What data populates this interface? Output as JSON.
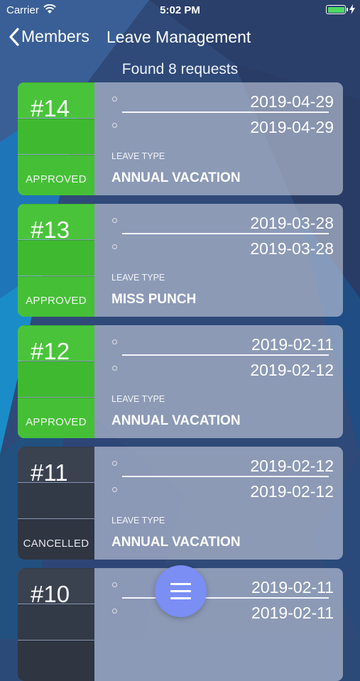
{
  "status_bar": {
    "carrier": "Carrier",
    "time": "5:02 PM",
    "battery_level": 1.0
  },
  "nav": {
    "back_label": "Members",
    "title": "Leave Management"
  },
  "summary": "Found 8 requests",
  "requests": [
    {
      "number": "#14",
      "status": "APPROVED",
      "from": "2019-04-29",
      "to": "2019-04-29",
      "leave_type_label": "LEAVE TYPE",
      "leave_type": "ANNUAL VACATION"
    },
    {
      "number": "#13",
      "status": "APPROVED",
      "from": "2019-03-28",
      "to": "2019-03-28",
      "leave_type_label": "LEAVE TYPE",
      "leave_type": "MISS PUNCH"
    },
    {
      "number": "#12",
      "status": "APPROVED",
      "from": "2019-02-11",
      "to": "2019-02-12",
      "leave_type_label": "LEAVE TYPE",
      "leave_type": "ANNUAL VACATION"
    },
    {
      "number": "#11",
      "status": "CANCELLED",
      "from": "2019-02-12",
      "to": "2019-02-12",
      "leave_type_label": "LEAVE TYPE",
      "leave_type": "ANNUAL VACATION"
    },
    {
      "number": "#10",
      "status": "",
      "from": "2019-02-11",
      "to": "2019-02-11",
      "leave_type_label": "",
      "leave_type": ""
    }
  ],
  "colors": {
    "approved": "#45c036",
    "cancelled": "#333a47",
    "fab": "#7a8ef4",
    "card": "#d0d4e4"
  },
  "icons": {
    "back": "chevron-left-icon",
    "wifi": "wifi-icon",
    "menu": "hamburger-menu-icon"
  }
}
